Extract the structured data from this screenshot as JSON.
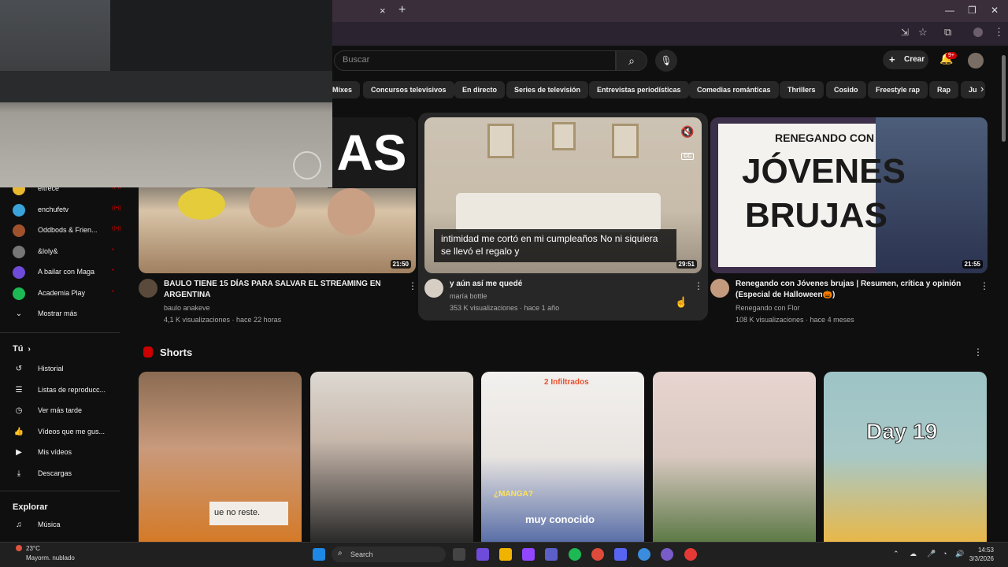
{
  "browser": {
    "tab_close": "×",
    "new_tab": "+",
    "win_min": "—",
    "win_max": "❐",
    "win_close": "✕"
  },
  "header": {
    "search_placeholder": "Buscar",
    "create_label": "Crear",
    "notifications_badge": "9+"
  },
  "chips": [
    "Mixes",
    "Concursos televisivos",
    "En directo",
    "Series de televisión",
    "Entrevistas periodísticas",
    "Comedias románticas",
    "Thrillers",
    "Cosido",
    "Freestyle rap",
    "Rap",
    "Ju"
  ],
  "sidebar": {
    "subscriptions": [
      {
        "label": "eltrece",
        "live": "((•))"
      },
      {
        "label": "enchufetv",
        "live": "((•))"
      },
      {
        "label": "Oddbods & Frien...",
        "live": "((•))"
      },
      {
        "label": "&loly&",
        "live": "•"
      },
      {
        "label": "A bailar con Maga",
        "live": "•"
      },
      {
        "label": "Academia Play",
        "live": "•"
      }
    ],
    "show_more": "Mostrar más",
    "you_heading": "Tú",
    "you_items": [
      "Historial",
      "Listas de reproducc...",
      "Ver más tarde",
      "Vídeos que me gus...",
      "Mis vídeos",
      "Descargas"
    ],
    "explore_heading": "Explorar",
    "explore_items": [
      "Música"
    ]
  },
  "videos": [
    {
      "title": "BAULO TIENE 15 DÍAS PARA SALVAR EL STREAMING EN ARGENTINA",
      "channel": "baulo anakeve",
      "meta": "4,1 K visualizaciones · hace 22 horas",
      "duration": "21:50",
      "thumb_text": "AS"
    },
    {
      "title": "y aún así me quedé",
      "channel": "maría bottle",
      "meta": "353 K visualizaciones · hace 1 año",
      "duration": "29:51",
      "caption": "intimidad me cortó en mi cumpleaños No ni siquiera se llevó el regalo y",
      "cc": "CC"
    },
    {
      "title": "Renegando con Jóvenes brujas | Resumen, crítica y opinión (Especial de Halloween🎃)",
      "channel": "Renegando con Flor",
      "meta": "108 K visualizaciones · hace 4 meses",
      "duration": "21:55",
      "thumb_line1": "RENEGANDO CON",
      "thumb_line2": "JÓVENES",
      "thumb_line3": "BRUJAS"
    }
  ],
  "shorts": {
    "heading": "Shorts",
    "items": [
      {
        "overlay": "ue no reste."
      },
      {
        "overlay": ""
      },
      {
        "overlay_top": "2 Infiltrados",
        "overlay_mid": "¿MANGA?",
        "overlay_bottom": "muy conocido"
      },
      {
        "overlay": ""
      },
      {
        "overlay": "Day 19"
      }
    ]
  },
  "taskbar": {
    "weather_temp": "23°C",
    "weather_desc": "Mayorm. nublado",
    "search_label": "Search",
    "time": "14:53",
    "date": "3/3/2026"
  },
  "colors": {
    "background": "#0f0f0f",
    "chip_bg": "#272727",
    "accent_red": "#cc0000"
  }
}
